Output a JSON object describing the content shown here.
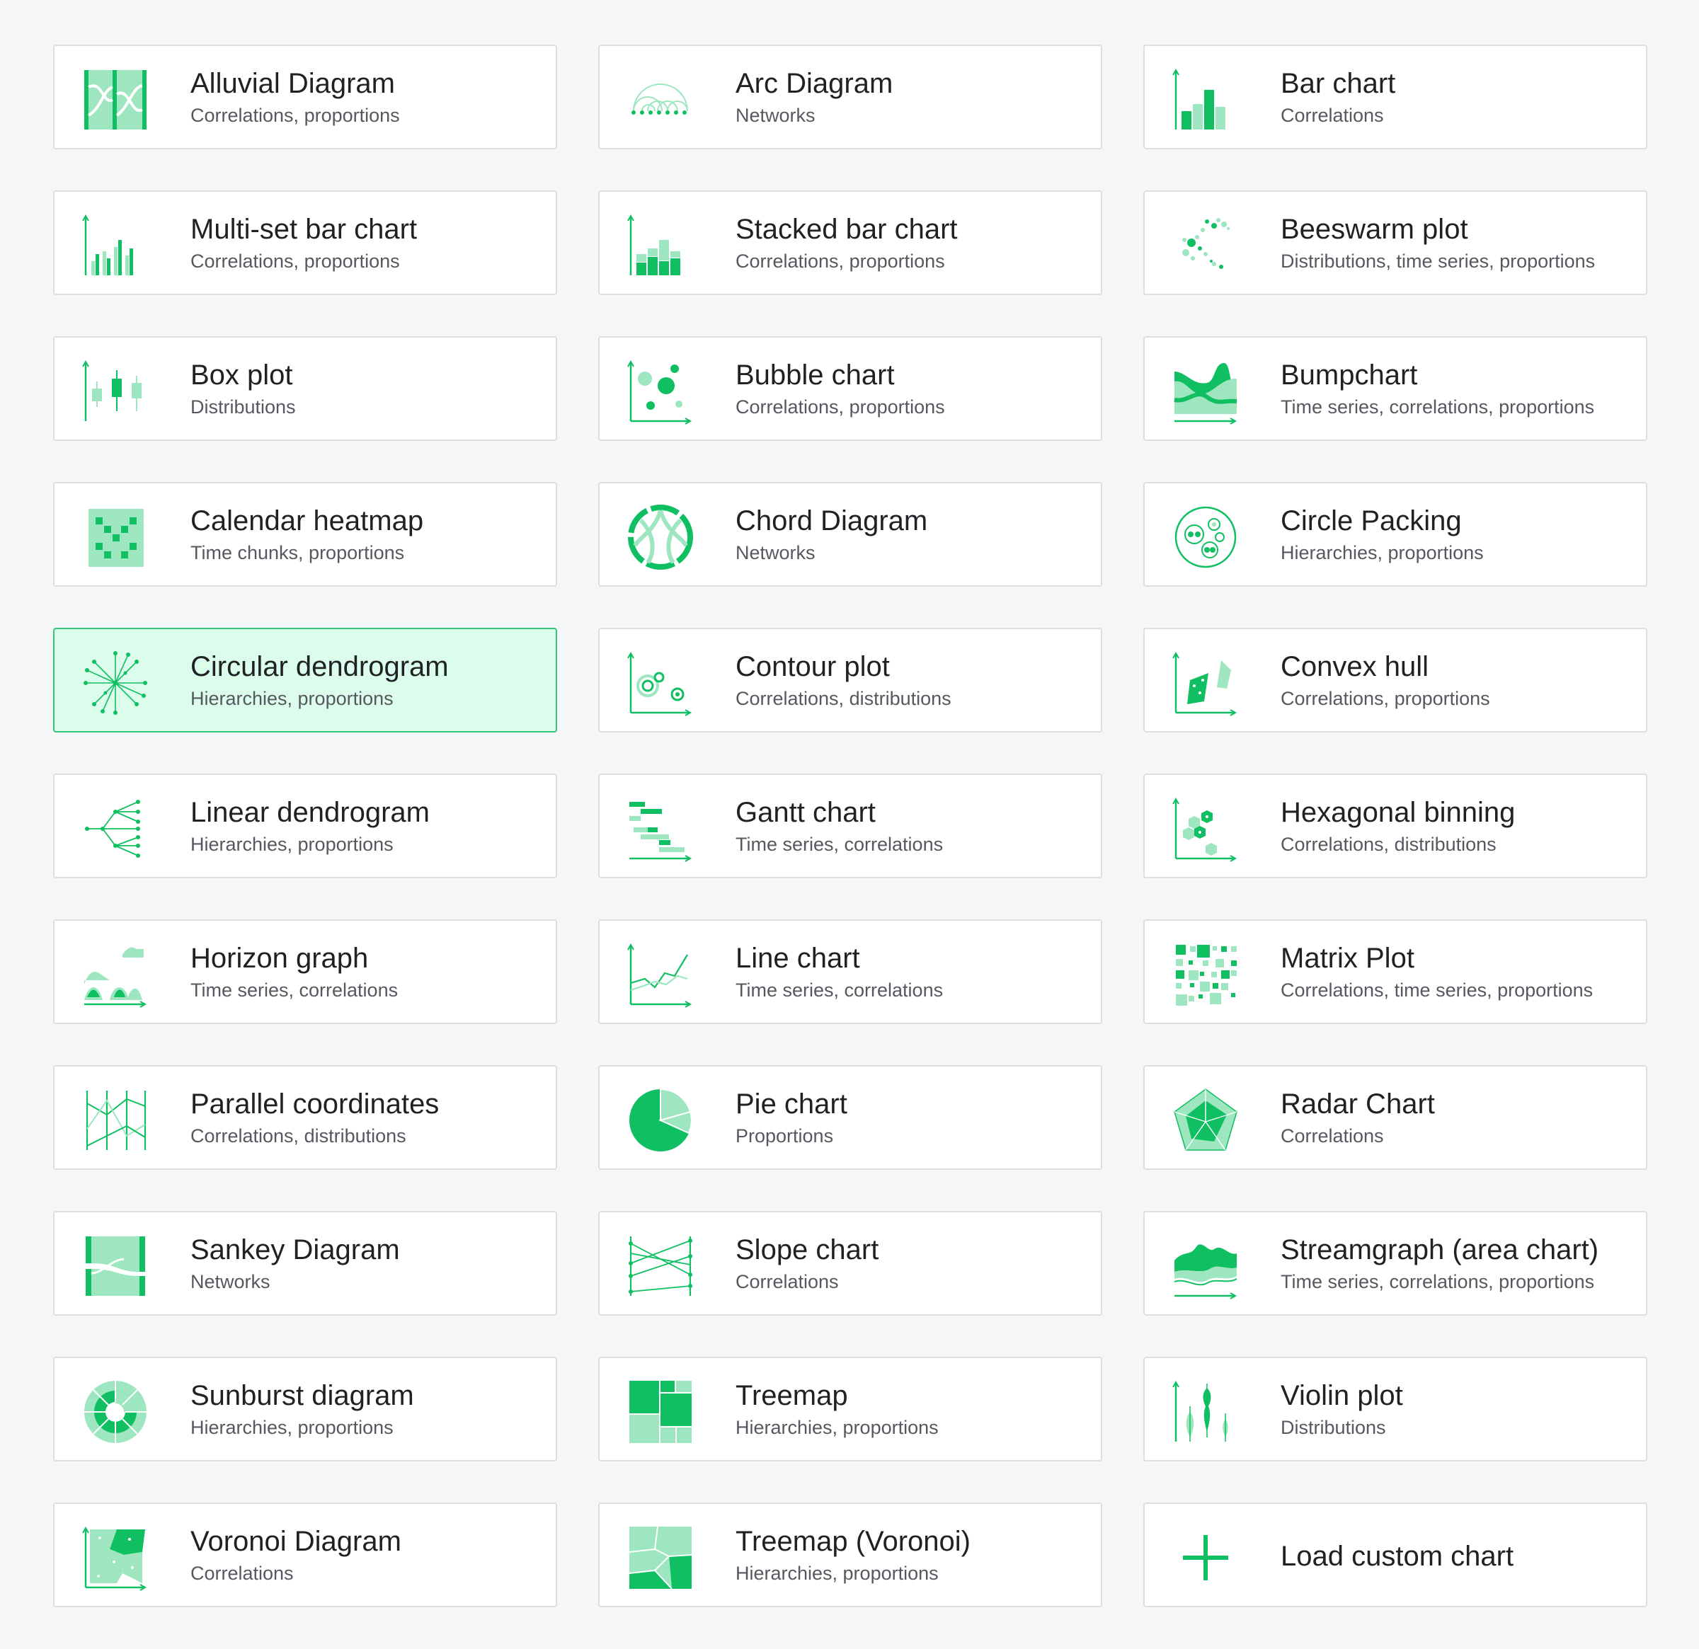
{
  "colors": {
    "accent": "#0fbf61",
    "accent_light": "#9de6c0",
    "selected_bg": "#dcfdec"
  },
  "charts": [
    {
      "title": "Alluvial Diagram",
      "subtitle": "Correlations, proportions",
      "icon": "alluvial-icon"
    },
    {
      "title": "Arc Diagram",
      "subtitle": "Networks",
      "icon": "arc-icon"
    },
    {
      "title": "Bar chart",
      "subtitle": "Correlations",
      "icon": "bar-icon"
    },
    {
      "title": "Multi-set bar chart",
      "subtitle": "Correlations, proportions",
      "icon": "multiset-bar-icon"
    },
    {
      "title": "Stacked bar chart",
      "subtitle": "Correlations, proportions",
      "icon": "stacked-bar-icon"
    },
    {
      "title": "Beeswarm plot",
      "subtitle": "Distributions, time series, proportions",
      "icon": "beeswarm-icon"
    },
    {
      "title": "Box plot",
      "subtitle": "Distributions",
      "icon": "boxplot-icon"
    },
    {
      "title": "Bubble chart",
      "subtitle": "Correlations, proportions",
      "icon": "bubble-icon"
    },
    {
      "title": "Bumpchart",
      "subtitle": "Time series, correlations, proportions",
      "icon": "bump-icon"
    },
    {
      "title": "Calendar heatmap",
      "subtitle": "Time chunks, proportions",
      "icon": "calendar-icon"
    },
    {
      "title": "Chord Diagram",
      "subtitle": "Networks",
      "icon": "chord-icon"
    },
    {
      "title": "Circle Packing",
      "subtitle": "Hierarchies, proportions",
      "icon": "circle-packing-icon"
    },
    {
      "title": "Circular dendrogram",
      "subtitle": "Hierarchies, proportions",
      "icon": "circular-dendrogram-icon",
      "selected": true
    },
    {
      "title": "Contour plot",
      "subtitle": "Correlations, distributions",
      "icon": "contour-icon"
    },
    {
      "title": "Convex hull",
      "subtitle": "Correlations, proportions",
      "icon": "convex-hull-icon"
    },
    {
      "title": "Linear dendrogram",
      "subtitle": "Hierarchies, proportions",
      "icon": "linear-dendrogram-icon"
    },
    {
      "title": "Gantt chart",
      "subtitle": "Time series, correlations",
      "icon": "gantt-icon"
    },
    {
      "title": "Hexagonal binning",
      "subtitle": "Correlations, distributions",
      "icon": "hexbin-icon"
    },
    {
      "title": "Horizon graph",
      "subtitle": "Time series, correlations",
      "icon": "horizon-icon"
    },
    {
      "title": "Line chart",
      "subtitle": "Time series, correlations",
      "icon": "line-icon"
    },
    {
      "title": "Matrix Plot",
      "subtitle": "Correlations, time series, proportions",
      "icon": "matrix-icon"
    },
    {
      "title": "Parallel coordinates",
      "subtitle": "Correlations, distributions",
      "icon": "parallel-icon"
    },
    {
      "title": "Pie chart",
      "subtitle": "Proportions",
      "icon": "pie-icon"
    },
    {
      "title": "Radar Chart",
      "subtitle": "Correlations",
      "icon": "radar-icon"
    },
    {
      "title": "Sankey Diagram",
      "subtitle": "Networks",
      "icon": "sankey-icon"
    },
    {
      "title": "Slope chart",
      "subtitle": "Correlations",
      "icon": "slope-icon"
    },
    {
      "title": "Streamgraph (area chart)",
      "subtitle": "Time series, correlations, proportions",
      "icon": "streamgraph-icon"
    },
    {
      "title": "Sunburst diagram",
      "subtitle": "Hierarchies, proportions",
      "icon": "sunburst-icon"
    },
    {
      "title": "Treemap",
      "subtitle": "Hierarchies, proportions",
      "icon": "treemap-icon"
    },
    {
      "title": "Violin plot",
      "subtitle": "Distributions",
      "icon": "violin-icon"
    },
    {
      "title": "Voronoi Diagram",
      "subtitle": "Correlations",
      "icon": "voronoi-icon"
    },
    {
      "title": "Treemap (Voronoi)",
      "subtitle": "Hierarchies, proportions",
      "icon": "voronoi-treemap-icon"
    },
    {
      "title": "Load custom chart",
      "subtitle": "",
      "icon": "plus-icon",
      "custom": true
    }
  ]
}
